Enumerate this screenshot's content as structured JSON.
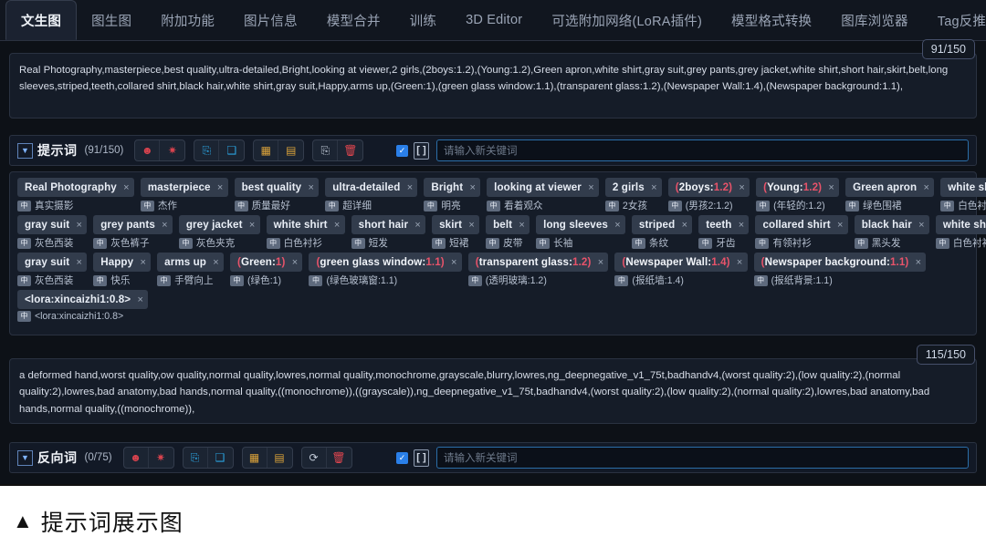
{
  "tabs": [
    {
      "label": "文生图",
      "active": true
    },
    {
      "label": "图生图",
      "active": false
    },
    {
      "label": "附加功能",
      "active": false
    },
    {
      "label": "图片信息",
      "active": false
    },
    {
      "label": "模型合并",
      "active": false
    },
    {
      "label": "训练",
      "active": false
    },
    {
      "label": "3D Editor",
      "active": false
    },
    {
      "label": "可选附加网络(LoRA插件)",
      "active": false
    },
    {
      "label": "模型格式转换",
      "active": false
    },
    {
      "label": "图库浏览器",
      "active": false
    },
    {
      "label": "Tag反推(Tagger)",
      "active": false
    }
  ],
  "positive": {
    "counter": "91/150",
    "text": "Real Photography,masterpiece,best quality,ultra-detailed,Bright,looking at viewer,2 girls,(2boys:1.2),(Young:1.2),Green apron,white shirt,gray suit,grey pants,grey jacket,white shirt,short hair,skirt,belt,long sleeves,striped,teeth,collared shirt,black hair,white shirt,gray suit,Happy,arms up,(Green:1),(green glass window:1.1),(transparent glass:1.2),(Newspaper Wall:1.4),(Newspaper background:1.1),",
    "toolbar": {
      "caret": "▼",
      "title": "提示词",
      "count": "(91/150)",
      "buttons": [
        {
          "name": "emoji-red-icon",
          "glyph": "☻",
          "color": "#d9434e"
        },
        {
          "name": "settings-red-icon",
          "glyph": "✷",
          "color": "#d9434e"
        },
        {
          "name": "translate-blue-icon",
          "glyph": "⎘",
          "color": "#2ba3e0"
        },
        {
          "name": "bookmark-blue-icon",
          "glyph": "❑",
          "color": "#2ba3e0"
        },
        {
          "name": "grid-orange-icon",
          "glyph": "▦",
          "color": "#d7a03a"
        },
        {
          "name": "export-orange-icon",
          "glyph": "▤",
          "color": "#d7a03a"
        },
        {
          "name": "copy-icon",
          "glyph": "⎘",
          "color": "#c3ccd9"
        },
        {
          "name": "delete-red-icon",
          "glyph": "🗑",
          "color": "#e0464f"
        }
      ],
      "checkbox_checked": true,
      "bracket_label": "[ ]",
      "keyword_placeholder": "请输入新关键词"
    },
    "tag_rows": [
      [
        {
          "text": "Real Photography",
          "sub": "真实摄影",
          "weighted": false
        },
        {
          "text": "masterpiece",
          "sub": "杰作",
          "weighted": false
        },
        {
          "text": "best quality",
          "sub": "质量最好",
          "weighted": false
        },
        {
          "text": "ultra-detailed",
          "sub": "超详细",
          "weighted": false
        },
        {
          "text": "Bright",
          "sub": "明亮",
          "weighted": false
        },
        {
          "text": "looking at viewer",
          "sub": "看着观众",
          "weighted": false
        },
        {
          "text": "2 girls",
          "sub": "2女孩",
          "weighted": false
        },
        {
          "text": "(2boys:1.2)",
          "sub": "(男孩2:1.2)",
          "weighted": true
        },
        {
          "text": "(Young:1.2)",
          "sub": "(年轻的:1.2)",
          "weighted": true
        },
        {
          "text": "Green apron",
          "sub": "绿色围裙",
          "weighted": false
        },
        {
          "text": "white shirt",
          "sub": "白色衬衫",
          "weighted": false
        }
      ],
      [
        {
          "text": "gray suit",
          "sub": "灰色西装",
          "weighted": false
        },
        {
          "text": "grey pants",
          "sub": "灰色裤子",
          "weighted": false
        },
        {
          "text": "grey jacket",
          "sub": "灰色夹克",
          "weighted": false
        },
        {
          "text": "white shirt",
          "sub": "白色衬衫",
          "weighted": false
        },
        {
          "text": "short hair",
          "sub": "短发",
          "weighted": false
        },
        {
          "text": "skirt",
          "sub": "短裙",
          "weighted": false
        },
        {
          "text": "belt",
          "sub": "皮带",
          "weighted": false
        },
        {
          "text": "long sleeves",
          "sub": "长袖",
          "weighted": false
        },
        {
          "text": "striped",
          "sub": "条纹",
          "weighted": false
        },
        {
          "text": "teeth",
          "sub": "牙齿",
          "weighted": false
        },
        {
          "text": "collared shirt",
          "sub": "有领衬衫",
          "weighted": false
        },
        {
          "text": "black hair",
          "sub": "黑头发",
          "weighted": false
        },
        {
          "text": "white shirt",
          "sub": "白色衬衫",
          "weighted": false
        }
      ],
      [
        {
          "text": "gray suit",
          "sub": "灰色西装",
          "weighted": false
        },
        {
          "text": "Happy",
          "sub": "快乐",
          "weighted": false
        },
        {
          "text": "arms up",
          "sub": "手臂向上",
          "weighted": false
        },
        {
          "text": "(Green:1)",
          "sub": "(绿色:1)",
          "weighted": true
        },
        {
          "text": "(green glass window:1.1)",
          "sub": "(绿色玻璃窗:1.1)",
          "weighted": true
        },
        {
          "text": "(transparent glass:1.2)",
          "sub": "(透明玻璃:1.2)",
          "weighted": true
        },
        {
          "text": "(Newspaper Wall:1.4)",
          "sub": "(报纸墙:1.4)",
          "weighted": true
        },
        {
          "text": "(Newspaper background:1.1)",
          "sub": "(报纸背景:1.1)",
          "weighted": true
        }
      ],
      [
        {
          "text": "<lora:xincaizhi1:0.8>",
          "sub": "<lora:xincaizhi1:0.8>",
          "weighted": false
        }
      ]
    ]
  },
  "negative": {
    "counter": "115/150",
    "text": "a deformed hand,worst quality,ow quality,normal quality,lowres,normal quality,monochrome,grayscale,blurry,lowres,ng_deepnegative_v1_75t,badhandv4,(worst quality:2),(low quality:2),(normal quality:2),lowres,bad anatomy,bad hands,normal quality,((monochrome)),((grayscale)),ng_deepnegative_v1_75t,badhandv4,(worst quality:2),(low quality:2),(normal quality:2),lowres,bad anatomy,bad hands,normal quality,((monochrome)),",
    "toolbar": {
      "caret": "▼",
      "title": "反向词",
      "count": "(0/75)",
      "buttons": [
        {
          "name": "emoji-red-icon",
          "glyph": "☻",
          "color": "#d9434e"
        },
        {
          "name": "settings-red-icon",
          "glyph": "✷",
          "color": "#d9434e"
        },
        {
          "name": "translate-blue-icon",
          "glyph": "⎘",
          "color": "#2ba3e0"
        },
        {
          "name": "bookmark-blue-icon",
          "glyph": "❑",
          "color": "#2ba3e0"
        },
        {
          "name": "grid-orange-icon",
          "glyph": "▦",
          "color": "#d7a03a"
        },
        {
          "name": "export-orange-icon",
          "glyph": "▤",
          "color": "#d7a03a"
        },
        {
          "name": "refresh-icon",
          "glyph": "⟳",
          "color": "#c3ccd9"
        },
        {
          "name": "delete-red-icon",
          "glyph": "🗑",
          "color": "#e0464f"
        }
      ],
      "checkbox_checked": true,
      "bracket_label": "[ ]",
      "keyword_placeholder": "请输入新关键词"
    }
  },
  "caption": {
    "triangle": "▲",
    "text": "提示词展示图"
  },
  "colors": {
    "panel_bg": "#0d1117",
    "field_bg": "#151c28",
    "chip_bg": "#323c4c",
    "accent_blue": "#2a7fe8",
    "weight_red": "#e8536a"
  }
}
